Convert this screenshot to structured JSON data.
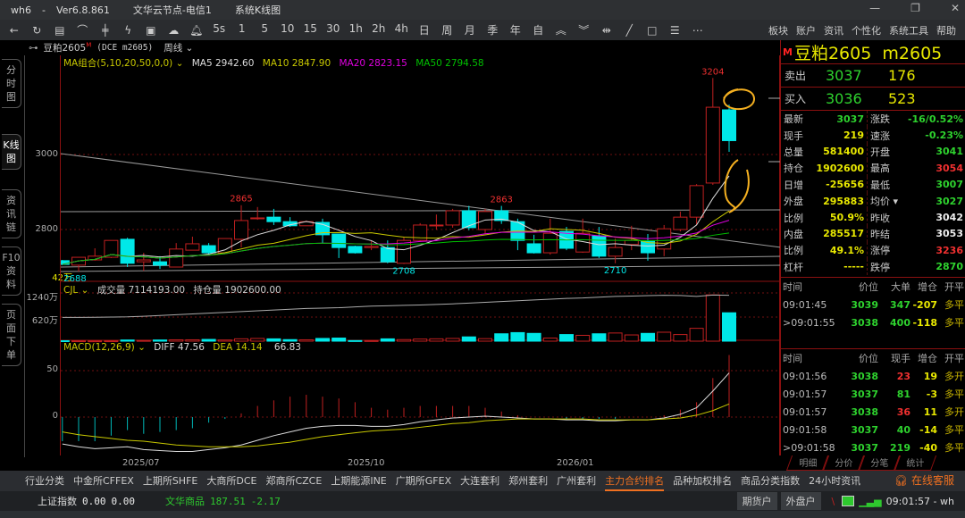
{
  "titlebar": {
    "app": "wh6",
    "version": "Ver6.8.861",
    "server": "文华云节点-电信1",
    "view": "系统K线图"
  },
  "window_controls": {
    "minimize": "—",
    "restore": "❐",
    "close": "✕"
  },
  "toolbar": {
    "icons": [
      "back-icon",
      "refresh-icon",
      "table-icon",
      "line-chart-icon",
      "candle-icon",
      "lightning-icon",
      "screen-icon",
      "cloud-icon",
      "bell-icon"
    ],
    "periods": [
      "5s",
      "1",
      "5",
      "10",
      "15",
      "30",
      "1h",
      "2h",
      "4h",
      "日",
      "周",
      "月",
      "季",
      "年",
      "自"
    ],
    "right_menu": [
      "板块",
      "账户",
      "资讯",
      "个性化",
      "系统工具",
      "帮助"
    ]
  },
  "symbol": {
    "name": "豆粕2605",
    "flag": "M",
    "exchange": "(DCE m2605)",
    "period": "周线"
  },
  "left_tabs": [
    "分时图",
    "K线图",
    "资讯链",
    "F10资料",
    "页面下单"
  ],
  "main_indicator": {
    "label": "MA组合(5,10,20,50,0,0)",
    "ma5": "MA5 2942.60",
    "ma10": "MA10 2847.90",
    "ma20": "MA20 2823.15",
    "ma50": "MA50 2794.58"
  },
  "vol_indicator": {
    "label": "CJL",
    "volume": "成交量 7114193.00",
    "oi": "持仓量 1902600.00"
  },
  "macd_indicator": {
    "label": "MACD(12,26,9)",
    "diff": "DIFF 47.56",
    "dea": "DEA 14.14",
    "macd": "66.83"
  },
  "y_labels": {
    "p3000": "3000",
    "p2800": "2800",
    "v1240": "1240万",
    "v620": "620万",
    "m50": "50",
    "m0": "0",
    "vol_last": "42万"
  },
  "dates": [
    "2025/07",
    "2025/10",
    "2026/01"
  ],
  "colors": {
    "up": "#c02020",
    "down": "#00e8e8",
    "ma5": "#dddddd",
    "ma10": "#c8c800",
    "ma20": "#e000e0",
    "ma50": "#00c000",
    "annot": "#f5b020"
  },
  "chart_data": {
    "type": "candlestick",
    "price_annotations": {
      "high1": "2865",
      "high2": "2863",
      "high3": "3204",
      "low1": "2688",
      "low2": "2708",
      "low3": "2710"
    },
    "ohlc": [
      [
        2717,
        2719,
        2705,
        2707
      ],
      [
        2705,
        2726,
        2688,
        2726
      ],
      [
        2719,
        2750,
        2717,
        2729
      ],
      [
        2726,
        2771,
        2724,
        2771
      ],
      [
        2774,
        2778,
        2700,
        2710
      ],
      [
        2714,
        2738,
        2690,
        2719
      ],
      [
        2714,
        2729,
        2695,
        2705
      ],
      [
        2700,
        2764,
        2700,
        2748
      ],
      [
        2745,
        2781,
        2745,
        2762
      ],
      [
        2757,
        2764,
        2733,
        2738
      ],
      [
        2738,
        2776,
        2736,
        2776
      ],
      [
        2774,
        2865,
        2752,
        2824
      ],
      [
        2829,
        2860,
        2826,
        2831
      ],
      [
        2833,
        2855,
        2812,
        2821
      ],
      [
        2821,
        2833,
        2807,
        2810
      ],
      [
        2810,
        2824,
        2810,
        2821
      ],
      [
        2819,
        2829,
        2764,
        2786
      ],
      [
        2788,
        2788,
        2724,
        2752
      ],
      [
        2755,
        2757,
        2736,
        2738
      ],
      [
        2752,
        2769,
        2745,
        2755
      ],
      [
        2752,
        2771,
        2710,
        2714
      ],
      [
        2710,
        2781,
        2708,
        2771
      ],
      [
        2771,
        2817,
        2767,
        2812
      ],
      [
        2812,
        2840,
        2800,
        2812
      ],
      [
        2812,
        2855,
        2805,
        2850
      ],
      [
        2850,
        2863,
        2798,
        2805
      ],
      [
        2800,
        2855,
        2790,
        2848
      ],
      [
        2850,
        2863,
        2815,
        2824
      ],
      [
        2821,
        2829,
        2745,
        2771
      ],
      [
        2762,
        2786,
        2736,
        2738
      ],
      [
        2738,
        2829,
        2733,
        2790
      ],
      [
        2795,
        2807,
        2745,
        2750
      ],
      [
        2740,
        2829,
        2738,
        2790
      ],
      [
        2783,
        2807,
        2724,
        2729
      ],
      [
        2729,
        2776,
        2710,
        2752
      ],
      [
        2760,
        2810,
        2745,
        2771
      ],
      [
        2769,
        2788,
        2717,
        2738
      ],
      [
        2748,
        2812,
        2729,
        2802
      ],
      [
        2800,
        2848,
        2795,
        2833
      ],
      [
        2833,
        2921,
        2812,
        2917
      ],
      [
        2924,
        3204,
        2919,
        3126
      ],
      [
        3119,
        3133,
        3007,
        3037
      ]
    ],
    "volume_wan": [
      12,
      10,
      8,
      10,
      30,
      20,
      30,
      35,
      35,
      45,
      30,
      60,
      70,
      60,
      40,
      35,
      70,
      80,
      15,
      15,
      60,
      40,
      55,
      60,
      70,
      110,
      65,
      190,
      220,
      200,
      80,
      170,
      150,
      190,
      210,
      160,
      200,
      230,
      170,
      330,
      1190,
      730
    ],
    "oi_wan": [
      610,
      612,
      615,
      620,
      625,
      640,
      660,
      680,
      700,
      720,
      740,
      760,
      780,
      800,
      820,
      840,
      850,
      860,
      880,
      900,
      910,
      920,
      930,
      945,
      960,
      980,
      1000,
      1020,
      1040,
      1060,
      1080,
      1100,
      1110,
      1130,
      1150,
      1160,
      1170,
      1180,
      1175,
      1150,
      1185,
      1180
    ],
    "diff": [
      -29,
      -32,
      -34,
      -33,
      -32,
      -35,
      -36,
      -37,
      -37,
      -35,
      -33,
      -30,
      -25,
      -20,
      -16,
      -12,
      -10,
      -9,
      -9,
      -10,
      -10,
      -8,
      -5,
      -3,
      -1,
      0,
      1,
      0,
      -1,
      -2,
      -2,
      -3,
      -3,
      -4,
      -4,
      -3,
      -3,
      -1,
      3,
      10,
      28,
      47.56
    ],
    "dea": [
      -16,
      -19,
      -21,
      -23,
      -25,
      -26,
      -28,
      -30,
      -31,
      -32,
      -32,
      -32,
      -31,
      -29,
      -27,
      -24,
      -21,
      -19,
      -17,
      -15,
      -14,
      -13,
      -11,
      -9,
      -7,
      -6,
      -4,
      -3,
      -2,
      -2,
      -2,
      -2,
      -2,
      -3,
      -3,
      -3,
      -3,
      -2,
      -1,
      2,
      7,
      14.14
    ],
    "ylim_price": [
      2640,
      3240
    ],
    "ylim_volume_wan": [
      0,
      1350
    ],
    "ylim_macd": [
      -45,
      110
    ]
  },
  "quote": {
    "title": "豆粕2605  m2605",
    "flag": "M",
    "sell_label": "卖出",
    "sell_price": "3037",
    "sell_vol": "176",
    "buy_label": "买入",
    "buy_price": "3036",
    "buy_vol": "523",
    "left": [
      [
        "最新",
        "3037",
        "#2ed22e"
      ],
      [
        "现手",
        "219",
        "#e8e800"
      ],
      [
        "总量",
        "581400",
        "#e8e800"
      ],
      [
        "持仓",
        "1902600",
        "#e8e800"
      ],
      [
        "日增",
        "-25656",
        "#e8e800"
      ],
      [
        "外盘",
        "295883",
        "#e8e800"
      ],
      [
        "比例",
        "50.9%",
        "#e8e800"
      ],
      [
        "内盘",
        "285517",
        "#e8e800"
      ],
      [
        "比例",
        "49.1%",
        "#e8e800"
      ],
      [
        "杠杆",
        "-----",
        "#e8e800"
      ]
    ],
    "right": [
      [
        "涨跌",
        "-16/0.52%",
        "#2ed22e"
      ],
      [
        "速涨",
        "-0.23%",
        "#2ed22e"
      ],
      [
        "开盘",
        "3041",
        "#2ed22e"
      ],
      [
        "最高",
        "3054",
        "#f03030"
      ],
      [
        "最低",
        "3007",
        "#2ed22e"
      ],
      [
        "均价 ▾",
        "3027",
        "#2ed22e"
      ],
      [
        "昨收",
        "3042",
        "#eeeeee"
      ],
      [
        "昨结",
        "3053",
        "#eeeeee"
      ],
      [
        "涨停",
        "3236",
        "#f03030"
      ],
      [
        "跌停",
        "2870",
        "#2ed22e"
      ]
    ]
  },
  "big_orders": {
    "headers": [
      "时间",
      "价位",
      "大单",
      "增仓",
      "开平"
    ],
    "rows": [
      [
        "09:01:45",
        "3039",
        "347",
        "-207",
        "多平"
      ],
      [
        ">09:01:55",
        "3038",
        "400",
        "-118",
        "多平"
      ]
    ]
  },
  "ticks": {
    "headers": [
      "时间",
      "价位",
      "现手",
      "增仓",
      "开平"
    ],
    "rows": [
      [
        "09:01:56",
        "3038",
        "23",
        "19",
        "多开",
        "#f03030"
      ],
      [
        "09:01:57",
        "3037",
        "81",
        "-3",
        "多平",
        "#2ed22e"
      ],
      [
        "09:01:57",
        "3038",
        "36",
        "11",
        "多开",
        "#f03030"
      ],
      [
        "09:01:58",
        "3037",
        "40",
        "-14",
        "多平",
        "#2ed22e"
      ],
      [
        ">09:01:58",
        "3037",
        "219",
        "-40",
        "多平",
        "#2ed22e"
      ]
    ]
  },
  "bottom_tabs": [
    "明细",
    "分价",
    "分笔",
    "统计"
  ],
  "nav": [
    "行业分类",
    "中金所CFFEX",
    "上期所SHFE",
    "大商所DCE",
    "郑商所CZCE",
    "上期能源INE",
    "广期所GFEX",
    "大连套利",
    "郑州套利",
    "广州套利",
    "主力合约排名",
    "品种加权排名",
    "商品分类指数",
    "24小时资讯"
  ],
  "nav_active": 10,
  "service": "在线客服",
  "status": {
    "idx1_name": "上证指数",
    "idx1_val": "0.00",
    "idx1_chg": "0.00",
    "idx2_name": "文华商品",
    "idx2_val": "187.51",
    "idx2_chg": "-2.17",
    "btn1": "期货户",
    "btn2": "外盘户",
    "time": "09:01:57 - wh"
  }
}
